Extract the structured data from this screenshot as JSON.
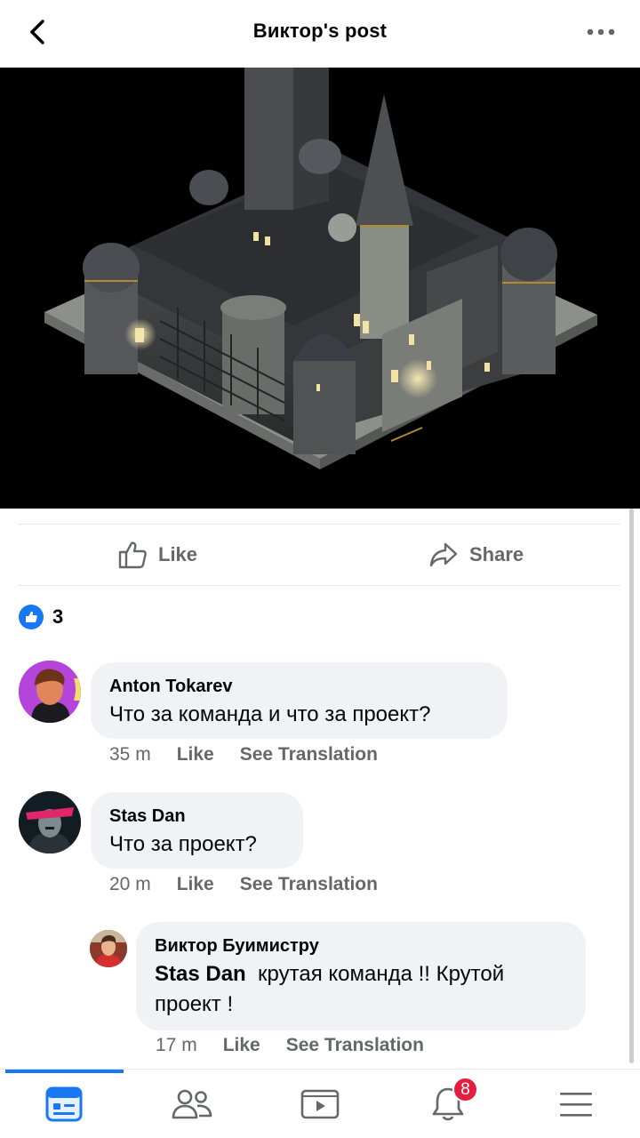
{
  "header": {
    "title": "Виктор's post"
  },
  "actions": {
    "like_label": "Like",
    "share_label": "Share"
  },
  "reactions": {
    "count": "3"
  },
  "comments": [
    {
      "author": "Anton Tokarev",
      "text": "Что за команда и что за проект?",
      "time": "35 m",
      "like_label": "Like",
      "translate_label": "See Translation"
    },
    {
      "author": "Stas Dan",
      "text": "Что за проект?",
      "time": "20 m",
      "like_label": "Like",
      "translate_label": "See Translation"
    }
  ],
  "reply": {
    "author": "Виктор Буимистру",
    "mention": "Stas Dan",
    "text": "крутая команда !! Крутой проект !",
    "time": "17 m",
    "like_label": "Like",
    "translate_label": "See Translation"
  },
  "tabbar": {
    "items": [
      {
        "icon": "news-feed-icon",
        "active": true
      },
      {
        "icon": "friends-icon",
        "active": false
      },
      {
        "icon": "video-icon",
        "active": false
      },
      {
        "icon": "notifications-bell-icon",
        "active": false
      },
      {
        "icon": "menu-icon",
        "active": false
      }
    ],
    "notifications_badge": "8"
  },
  "colors": {
    "accent": "#1877f2",
    "badge": "#e41e3f",
    "bubble": "#f0f2f5",
    "secondary_text": "#65676b"
  }
}
